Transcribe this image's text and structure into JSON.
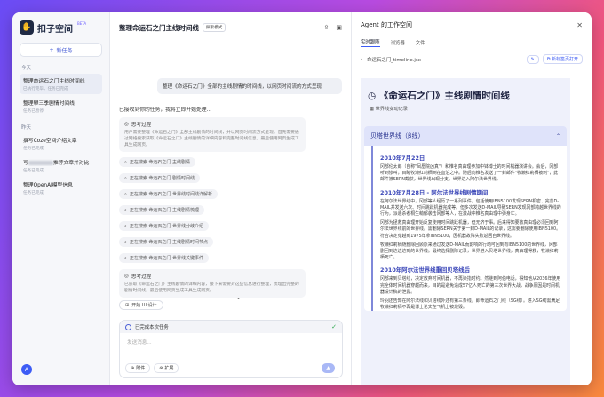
{
  "sidebar": {
    "brand": "扣子空间",
    "beta": "BETA",
    "new_task": "新任务",
    "groups": [
      {
        "label": "今天",
        "items": [
          {
            "title": "整理命运石之门主线时间线",
            "sub": "已执行完毕，任务已完成"
          },
          {
            "title": "整理攀三季剧情时间线",
            "sub": "任务已暂停"
          }
        ]
      },
      {
        "label": "昨天",
        "items": [
          {
            "title": "撰写Coze空间介绍文章",
            "sub": "任务已完成"
          },
          {
            "title": "写推荐文章并对比",
            "title_prefix": "写",
            "sub": "任务已完成"
          },
          {
            "title": "整理OpenAI模型信息",
            "sub": "任务已完成"
          }
        ]
      }
    ],
    "avatar": "A"
  },
  "chat": {
    "title": "整理命运石之门主线时间线",
    "mode_badge": "探索模式",
    "user_message": "整理《命运石之门》全部的主线剧情的时间线，以网页时间流的方式呈现",
    "reply": "已接收到你的任务，我将立即开始处理...",
    "think1": {
      "label": "思考过程",
      "text": "用户需要整理《命运石之门》全部主线剧情的时间线，并以网页时间流方式呈现。首先需要通过网络搜索获取《命运石之门》主线剧情的详细内容和完整时间线信息，最后使用网页生成工具生成网页。"
    },
    "searches": [
      "正在搜索 命运石之门 主线剧情",
      "正在搜索 命运石之门 剧情时间线",
      "正在搜索 命运石之门 世界线时间线详解析",
      "正在搜索 命运石之门 主线剧情梳理",
      "正在搜索 命运石之门 世界线分歧介绍",
      "正在搜索 命运石之门 主线剧情时间节点",
      "正在搜索 命运石之门 世界线关键事件"
    ],
    "think2": {
      "label": "思考过程",
      "text": "已获取《命运石之门》主线剧情的详细内容，接下来需要对这些信息进行整理，梳理出完整的剧情时间线，最后使用网页生成工具生成网页。"
    },
    "chip_ui": "开始 UI 设计",
    "done_task": "已完成本次任务",
    "input_placeholder": "发送消息...",
    "attach": "附件",
    "expand": "扩展"
  },
  "workspace": {
    "title": "Agent 的工作空间",
    "tabs": [
      "实时跟随",
      "浏览器",
      "文件"
    ],
    "active_tab": 0,
    "file_name": "命运石之门_timeline.jsx",
    "open_new_page": "新标签页打开",
    "doc": {
      "title": "《命运石之门》主线剧情时间线",
      "subtitle": "世界线变动记录",
      "section": "贝塔世界线（β线）",
      "events": [
        {
          "date": "2010年7月22日",
          "text": "冈部伦太郎（自称\"凤凰院凶真\"）和椎名真由理参加中钵博士的时间机器演讲会。会后，冈部听到惨叫，目睹牧濑红莉栖倒在血泊之中。随后向椎名发送了一封邮件\"牧濑红莉栖被刺\"，此邮件被SERN截获，世界线出现分支。世界进入阿尔法世界线。"
        },
        {
          "date": "2010年7月28日 - 阿尔法世界线剧情期间",
          "text": "在阿尔法世界线中，冈部等人经历了一系列事件，包括使用IBN5100发现SERN机密、完善D-MAIL并发送六次、时间跳跃机器完成等。但多次发送D-MAIL导致SERN发现冈部跨越世界线的行为，派遣杀者桐生萌郁袭击冈部等人，在激战中椎名真由理中弹身亡。"
        },
        {
          "date": "",
          "text": "冈部为拯救真由理开始反复使用时间跳跃机器，但无济于事。后来得知要救真由理必须回到阿尔法世界线前的世界线。需删除SERN关于第一封D-MAIL的记录，这需要删除使用IBN5100。符合决定穿越到1975年拿IBN5100，因机器故障失败返回自世界线。"
        },
        {
          "date": "",
          "text": "牧濑红莉栖随删除回顾原来通过发送D-MAIL而影响的行动可回到有IBN5100的世界线，冈部删回到达边达到的世界线。最终选择删除记录，世界进入贝塔世界线，真由理得救，牧濑红莉栖死亡。"
        },
        {
          "date": "2010年阿尔法世界线重回贝塔线后",
          "text": "冈部来到贝塔线，决定放弃时间机器，不再染指时约。然继到阿伯电话，得知他从2036年使用完全体时间机器穿越而来，目的是避免造成57亿人死亡的第三次世界大战，战争原因是时间机器设计稿的泄露。"
        },
        {
          "date": "",
          "text": "玲羽还告知在阿尔法线和贝塔线外还有第三条线，即命运石之门线（SG线）。进入SG线需满足牧濑红莉栖不再是博士论文在飞机上被烧毁。"
        }
      ]
    }
  }
}
